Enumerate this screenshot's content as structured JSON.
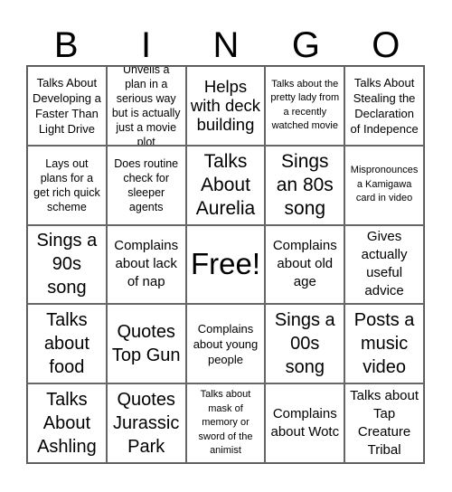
{
  "header": {
    "letters": [
      "B",
      "I",
      "N",
      "G",
      "O"
    ]
  },
  "cells": [
    "Talks About Developing a Faster Than Light Drive",
    "Unveils a plan in a serious way but is actually just a movie plot",
    "Helps with deck building",
    "Talks about the pretty lady from a recently watched movie",
    "Talks About Stealing the Declaration of Indepence",
    "Lays out plans for a get rich quick scheme",
    "Does routine check for sleeper agents",
    "Talks About Aurelia",
    "Sings an 80s song",
    "Mispronounces a Kamigawa card in video",
    "Sings a 90s song",
    "Complains about lack of nap",
    "Free!",
    "Complains about old age",
    "Gives actually useful advice",
    "Talks about food",
    "Quotes Top Gun",
    "Complains about young people",
    "Sings a 00s song",
    "Posts a music video",
    "Talks About Ashling",
    "Quotes Jurassic Park",
    "Talks about mask of memory or sword of the animist",
    "Complains about Wotc",
    "Talks about Tap Creature Tribal"
  ]
}
